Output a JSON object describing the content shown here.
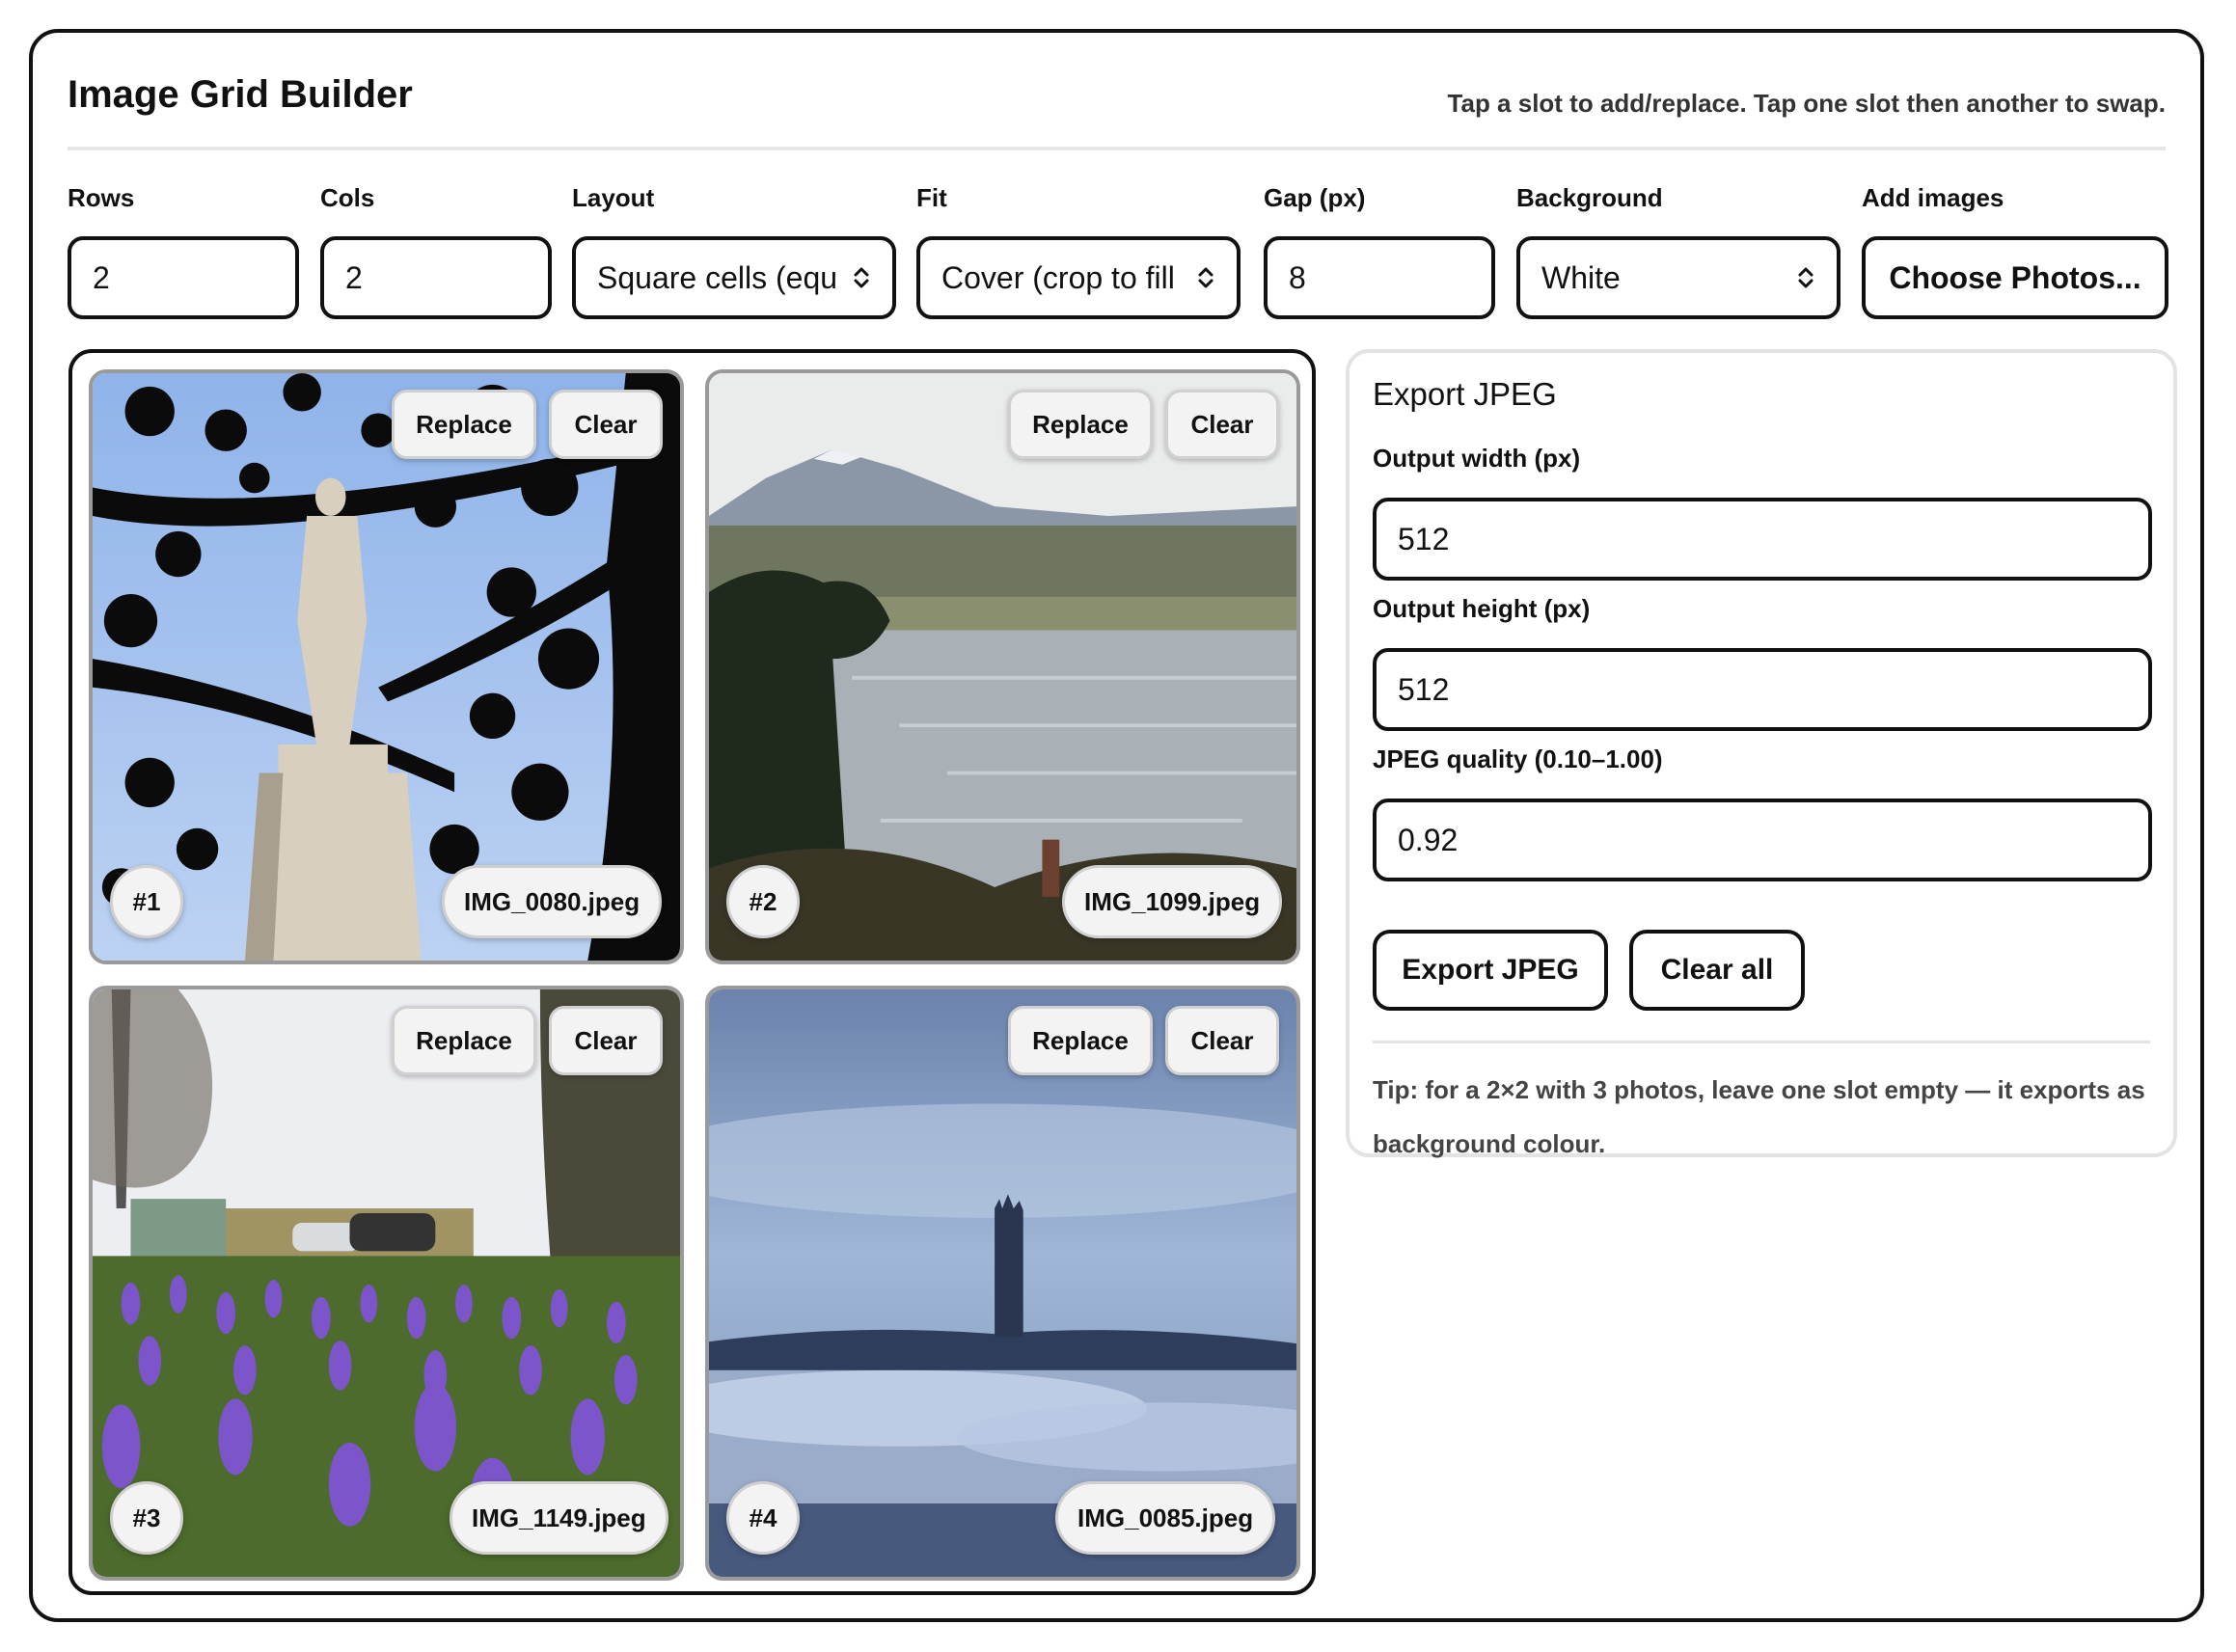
{
  "app": {
    "title": "Image Grid Builder",
    "hint": "Tap a slot to add/replace. Tap one slot then another to swap."
  },
  "controls": {
    "rows": {
      "label": "Rows",
      "value": "2"
    },
    "cols": {
      "label": "Cols",
      "value": "2"
    },
    "layout": {
      "label": "Layout",
      "value": "Square cells (equ"
    },
    "fit": {
      "label": "Fit",
      "value": "Cover (crop to fill"
    },
    "gap": {
      "label": "Gap (px)",
      "value": "8"
    },
    "background": {
      "label": "Background",
      "value": "White"
    },
    "add_images": {
      "label": "Add images",
      "button": "Choose Photos..."
    }
  },
  "grid": {
    "replace_label": "Replace",
    "clear_label": "Clear",
    "cells": [
      {
        "number": "#1",
        "filename": "IMG_0080.jpeg"
      },
      {
        "number": "#2",
        "filename": "IMG_1099.jpeg"
      },
      {
        "number": "#3",
        "filename": "IMG_1149.jpeg"
      },
      {
        "number": "#4",
        "filename": "IMG_0085.jpeg"
      }
    ]
  },
  "export": {
    "title": "Export JPEG",
    "width_label": "Output width (px)",
    "width_value": "512",
    "height_label": "Output height (px)",
    "height_value": "512",
    "quality_label": "JPEG quality (0.10–1.00)",
    "quality_value": "0.92",
    "export_button": "Export JPEG",
    "clear_all_button": "Clear all",
    "tip": "Tip: for a 2×2 with 3 photos, leave one slot empty — it exports as background colour."
  },
  "icons": {
    "select_chevron": "chevron-up-down-icon"
  },
  "colors": {
    "border": "#111111",
    "pill_bg": "#f3f3f3",
    "panel_border": "#e3e3e3"
  }
}
